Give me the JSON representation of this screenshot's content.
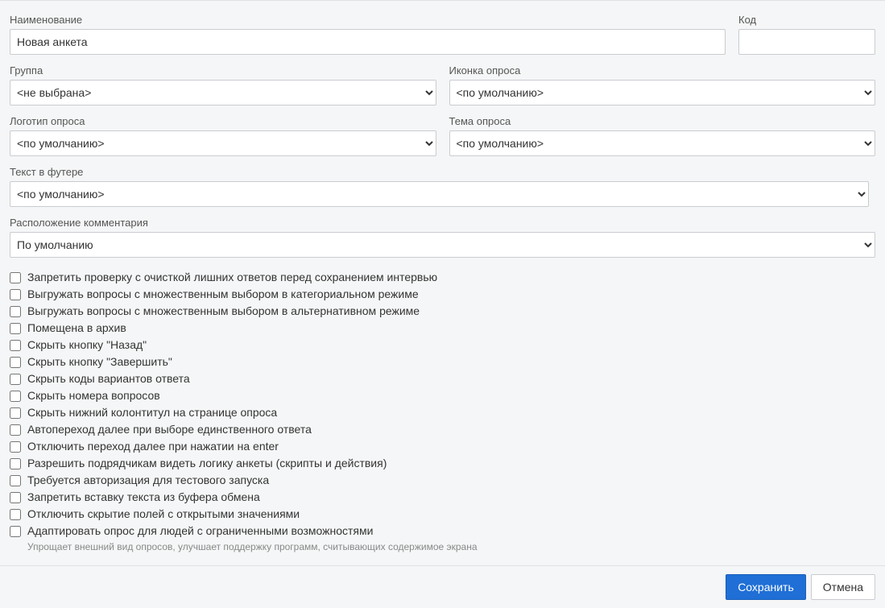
{
  "fields": {
    "name": {
      "label": "Наименование",
      "value": "Новая анкета"
    },
    "code": {
      "label": "Код",
      "value": ""
    },
    "group": {
      "label": "Группа",
      "value": "<не выбрана>"
    },
    "survey_icon": {
      "label": "Иконка опроса",
      "value": "<по умолчанию>"
    },
    "survey_logo": {
      "label": "Логотип опроса",
      "value": "<по умолчанию>"
    },
    "survey_theme": {
      "label": "Тема опроса",
      "value": "<по умолчанию>"
    },
    "footer_text": {
      "label": "Текст в футере",
      "value": "<по умолчанию>"
    },
    "comment_position": {
      "label": "Расположение комментария",
      "value": "По умолчанию"
    }
  },
  "checkboxes": [
    {
      "label": "Запретить проверку с очисткой лишних ответов перед сохранением интервью"
    },
    {
      "label": "Выгружать вопросы с множественным выбором в категориальном режиме"
    },
    {
      "label": "Выгружать вопросы с множественным выбором в альтернативном режиме"
    },
    {
      "label": "Помещена в архив"
    },
    {
      "label": "Скрыть кнопку \"Назад\""
    },
    {
      "label": "Скрыть кнопку \"Завершить\""
    },
    {
      "label": "Скрыть коды вариантов ответа"
    },
    {
      "label": "Скрыть номера вопросов"
    },
    {
      "label": "Скрыть нижний колонтитул на странице опроса"
    },
    {
      "label": "Автопереход далее при выборе единственного ответа"
    },
    {
      "label": "Отключить переход далее при нажатии на enter"
    },
    {
      "label": "Разрешить подрядчикам видеть логику анкеты (скрипты и действия)"
    },
    {
      "label": "Требуется авторизация для тестового запуска"
    },
    {
      "label": "Запретить вставку текста из буфера обмена"
    },
    {
      "label": "Отключить скрытие полей с открытыми значениями"
    },
    {
      "label": "Адаптировать опрос для людей с ограниченными возможностями",
      "helper": "Упрощает внешний вид опросов, улучшает поддержку программ, считывающих содержимое экрана"
    }
  ],
  "buttons": {
    "save": "Сохранить",
    "cancel": "Отмена"
  }
}
